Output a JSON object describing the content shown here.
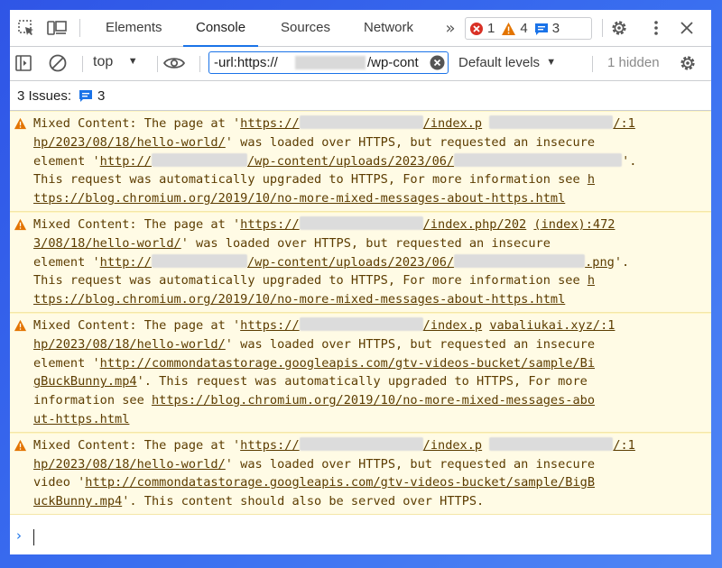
{
  "tabs": {
    "elements": "Elements",
    "console": "Console",
    "sources": "Sources",
    "network": "Network"
  },
  "badges": {
    "errors": "1",
    "warnings": "4",
    "messages": "3"
  },
  "toolbar": {
    "context": "top",
    "filter_prefix": "-url:https://",
    "filter_suffix": "/wp-cont",
    "levels": "Default levels",
    "hidden": "1 hidden"
  },
  "issues": {
    "label": "3 Issues:",
    "count": "3"
  },
  "messages": [
    {
      "l1a": "Mixed Content: The page at '",
      "l1link": "https://",
      "l1b": "/index.p",
      "l1src": "/:1",
      "l2link": "hp/2023/08/18/hello-world/",
      "l2b": "' was loaded over HTTPS, but requested an insecure",
      "l3a": "element '",
      "l3link": "http://",
      "l3b": "/wp-content/uploads/2023/06/",
      "l3c": "'.",
      "l4a": "This request was automatically upgraded to HTTPS, For more information see ",
      "l4link": "h",
      "l5link": "ttps://blog.chromium.org/2019/10/no-more-mixed-messages-about-https.html"
    },
    {
      "l1a": "Mixed Content: The page at '",
      "l1link": "https://",
      "l1b": "/index.php/202",
      "l1src": "(index):472",
      "l2link": "3/08/18/hello-world/",
      "l2b": "' was loaded over HTTPS, but requested an insecure",
      "l3a": "element '",
      "l3link": "http://",
      "l3b": "/wp-content/uploads/2023/06/",
      "l3c": ".png",
      "l3d": "'.",
      "l4a": "This request was automatically upgraded to HTTPS, For more information see ",
      "l4link": "h",
      "l5link": "ttps://blog.chromium.org/2019/10/no-more-mixed-messages-about-https.html"
    },
    {
      "l1a": "Mixed Content: The page at '",
      "l1link": "https://",
      "l1b": "/index.p",
      "l1src": "vabaliukai.xyz/:1",
      "l2link": "hp/2023/08/18/hello-world/",
      "l2b": "' was loaded over HTTPS, but requested an insecure",
      "l3a": "element '",
      "l3link": "http://commondatastorage.googleapis.com/gtv-videos-bucket/sample/Bi",
      "l4link": "gBuckBunny.mp4",
      "l4b": "'. This request was automatically upgraded to HTTPS, For more",
      "l5a": "information see ",
      "l5link": "https://blog.chromium.org/2019/10/no-more-mixed-messages-abo",
      "l6link": "ut-https.html"
    },
    {
      "l1a": "Mixed Content: The page at '",
      "l1link": "https://",
      "l1b": "/index.p",
      "l1src": "/:1",
      "l2link": "hp/2023/08/18/hello-world/",
      "l2b": "' was loaded over HTTPS, but requested an insecure",
      "l3a": "video '",
      "l3link": "http://commondatastorage.googleapis.com/gtv-videos-bucket/sample/BigB",
      "l4link": "uckBunny.mp4",
      "l4b": "'. This content should also be served over HTTPS."
    }
  ],
  "colors": {
    "accent": "#1a73e8",
    "warning_bg": "#fffbe5",
    "warning_text": "#5c3c00",
    "error": "#d93025",
    "warning_icon": "#e37400"
  }
}
